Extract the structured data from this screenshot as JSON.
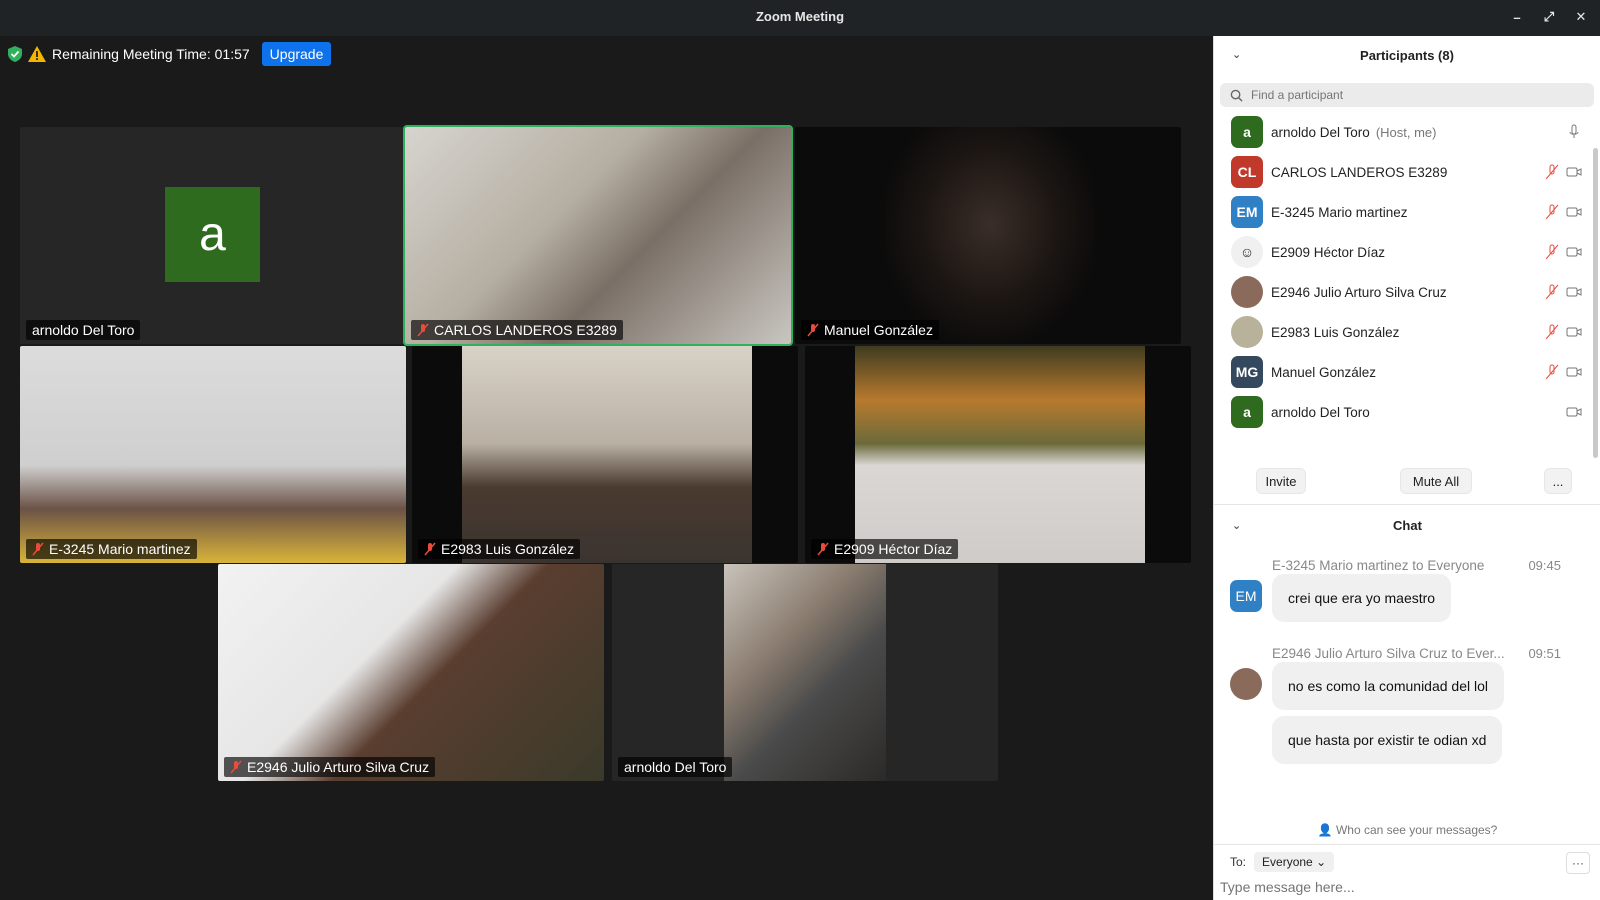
{
  "window": {
    "title": "Zoom Meeting"
  },
  "topbar": {
    "remaining_time_label": "Remaining Meeting Time: 01:57",
    "upgrade_label": "Upgrade"
  },
  "tiles": [
    {
      "name": "arnoldo Del Toro",
      "avatar_letter": "a",
      "muted": false,
      "video": false
    },
    {
      "name": "CARLOS LANDEROS E3289",
      "muted": true,
      "video": true,
      "active": true
    },
    {
      "name": "Manuel González",
      "muted": true,
      "video": true
    },
    {
      "name": "E-3245 Mario martinez",
      "muted": true,
      "video": true
    },
    {
      "name": "E2983 Luis González",
      "muted": true,
      "video": true
    },
    {
      "name": "E2909 Héctor Díaz",
      "muted": true,
      "video": true
    },
    {
      "name": "E2946 Julio Arturo Silva Cruz",
      "muted": true,
      "video": true
    },
    {
      "name": "arnoldo Del Toro",
      "muted": false,
      "video": true
    }
  ],
  "participants": {
    "title": "Participants (8)",
    "search_placeholder": "Find a participant",
    "items": [
      {
        "initials": "a",
        "color": "#2e6b1f",
        "name": "arnoldo Del Toro",
        "role": "(Host, me)",
        "mic": "on",
        "video": "none"
      },
      {
        "initials": "CL",
        "color": "#c0392b",
        "name": "CARLOS LANDEROS E3289",
        "role": "",
        "mic": "off",
        "video": "off"
      },
      {
        "initials": "EM",
        "color": "#2f80c4",
        "name": "E-3245 Mario martinez",
        "role": "",
        "mic": "off",
        "video": "off"
      },
      {
        "initials": "",
        "color": "#f0f0f0",
        "name": "E2909 Héctor Díaz",
        "role": "",
        "mic": "off",
        "video": "off"
      },
      {
        "initials": "",
        "color": "#8a6a5a",
        "name": "E2946 Julio Arturo Silva Cruz",
        "role": "",
        "mic": "off",
        "video": "off"
      },
      {
        "initials": "",
        "color": "#b9b29a",
        "name": "E2983 Luis González",
        "role": "",
        "mic": "off",
        "video": "off"
      },
      {
        "initials": "MG",
        "color": "#34495e",
        "name": "Manuel González",
        "role": "",
        "mic": "off",
        "video": "off"
      },
      {
        "initials": "a",
        "color": "#2e6b1f",
        "name": "arnoldo Del Toro",
        "role": "",
        "mic": "none",
        "video": "off"
      }
    ],
    "invite_label": "Invite",
    "mute_all_label": "Mute All",
    "more_label": "..."
  },
  "chat": {
    "title": "Chat",
    "messages": [
      {
        "sender": "E-3245 Mario martinez to Everyone",
        "time": "09:45",
        "avatar": "EM",
        "avatar_color": "#2f80c4",
        "texts": [
          "crei que era yo maestro"
        ]
      },
      {
        "sender": "E2946 Julio Arturo Silva Cruz to Ever...",
        "time": "09:51",
        "avatar": "",
        "avatar_color": "#8a6a5a",
        "texts": [
          "no es como la comunidad del lol",
          "que hasta por existir te odian xd"
        ]
      }
    ],
    "who_can_see": "Who can see your messages?",
    "to_label": "To:",
    "to_value": "Everyone",
    "compose_placeholder": "Type message here...",
    "more_label": "···"
  }
}
